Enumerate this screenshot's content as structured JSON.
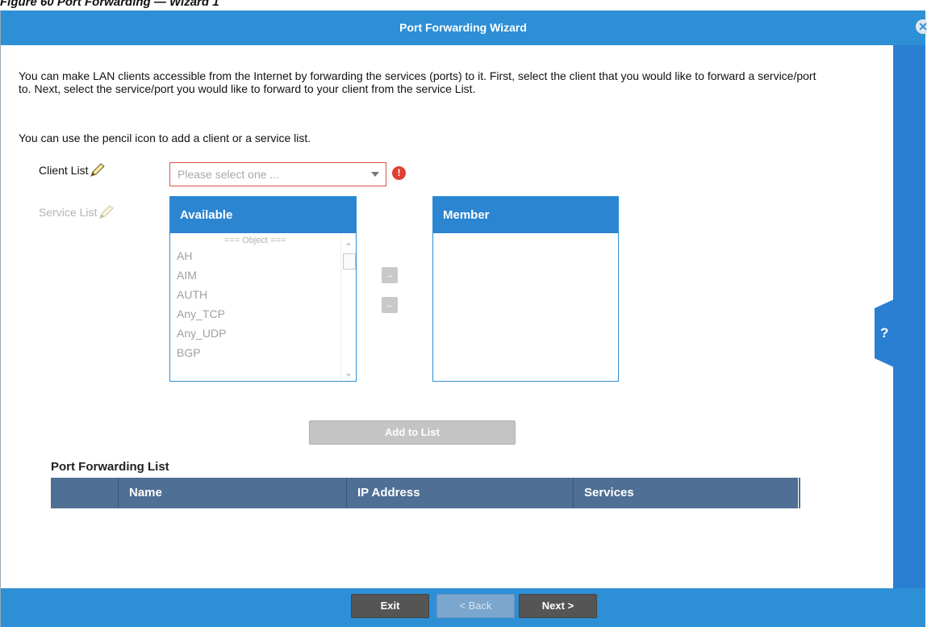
{
  "figure_caption": "Figure 60   Port Forwarding — Wizard 1",
  "dialog": {
    "title": "Port Forwarding Wizard",
    "close_icon": "close-icon",
    "help_label": "?"
  },
  "intro": {
    "paragraph1": "You can make LAN clients accessible from the Internet by forwarding the services (ports) to it. First, select the client that you would like to forward a service/port to. Next, select the service/port you would like to forward to your client from the service List.",
    "paragraph2": "You can use the pencil icon to add a client or a service list."
  },
  "client_list": {
    "label": "Client List",
    "placeholder": "Please select one ...",
    "error_icon": "!"
  },
  "service_list": {
    "label": "Service List",
    "available_header": "Available",
    "member_header": "Member",
    "group_header": "=== Object ===",
    "available_items": [
      "AH",
      "AIM",
      "AUTH",
      "Any_TCP",
      "Any_UDP",
      "BGP"
    ]
  },
  "move_buttons": {
    "add": "→",
    "remove": "←"
  },
  "add_to_list_label": "Add to List",
  "port_forwarding_list": {
    "title": "Port Forwarding List",
    "columns": [
      "Name",
      "IP Address",
      "Services"
    ]
  },
  "footer": {
    "exit_label": "Exit",
    "back_label": "< Back",
    "next_label": "Next >"
  },
  "colors": {
    "title_bar": "#2d8fd6",
    "panel_header": "#2b85d1",
    "table_header": "#4f6f94",
    "error": "#e04033"
  }
}
